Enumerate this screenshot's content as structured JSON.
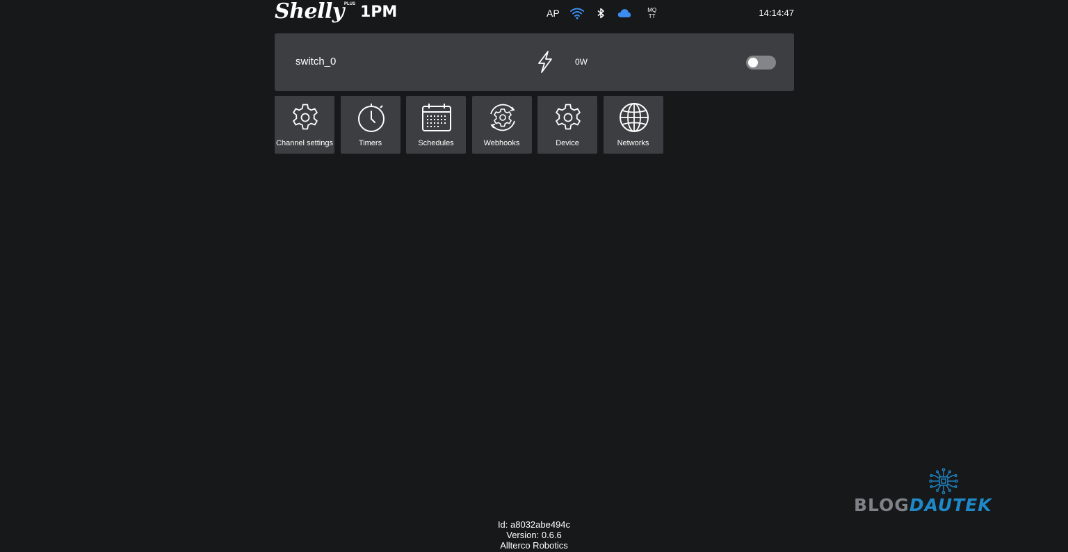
{
  "header": {
    "logo_text": "Shelly",
    "logo_plus": "PLUS",
    "logo_model": "1PM",
    "ap_label": "AP",
    "mqtt_line1": "MQ",
    "mqtt_line2": "TT",
    "time": "14:14:47",
    "icons": [
      "wifi-icon",
      "bluetooth-icon",
      "cloud-icon"
    ],
    "colors": {
      "wifi": "#3b8ef0",
      "cloud": "#3b8ef0"
    }
  },
  "switch": {
    "name": "switch_0",
    "power": "0W",
    "state": "off"
  },
  "tiles": [
    {
      "label": "Channel settings",
      "icon": "gear-icon"
    },
    {
      "label": "Timers",
      "icon": "timer-icon"
    },
    {
      "label": "Schedules",
      "icon": "calendar-icon"
    },
    {
      "label": "Webhooks",
      "icon": "webhook-icon"
    },
    {
      "label": "Device",
      "icon": "gear-icon"
    },
    {
      "label": "Networks",
      "icon": "globe-icon"
    }
  ],
  "footer": {
    "id": "Id: a8032abe494c",
    "version": "Version: 0.6.6",
    "vendor": "Allterco Robotics"
  },
  "watermark": {
    "part1": "BLOG",
    "part2": "DAUTEK"
  }
}
